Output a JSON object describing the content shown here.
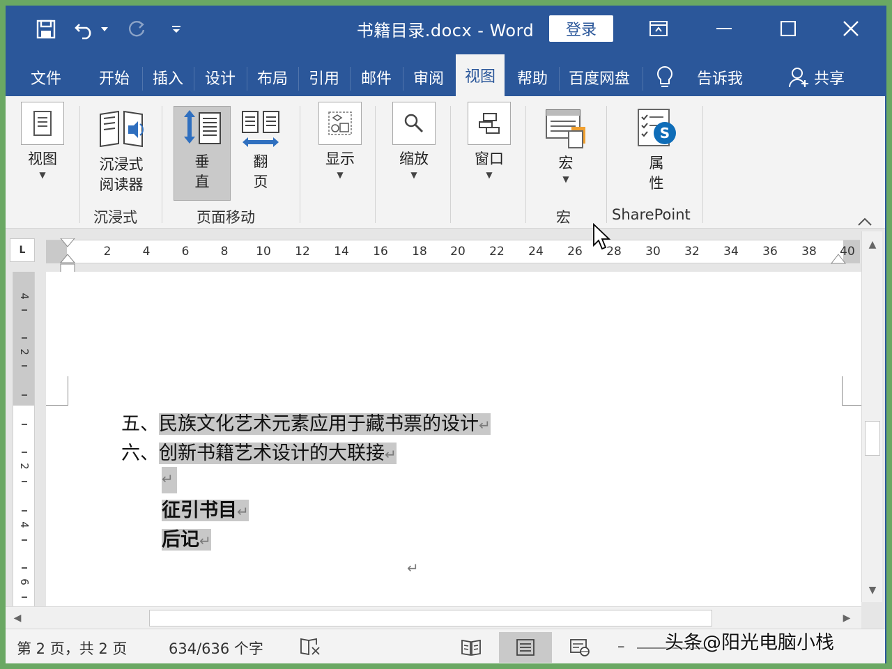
{
  "window": {
    "title": "书籍目录.docx  -  Word",
    "login_label": "登录"
  },
  "tabs": [
    "文件",
    "开始",
    "插入",
    "设计",
    "布局",
    "引用",
    "邮件",
    "审阅",
    "视图",
    "帮助",
    "百度网盘"
  ],
  "active_tab": "视图",
  "tellme_label": "告诉我",
  "share_label": "共享",
  "ribbon": {
    "view_label": "视图",
    "immersive_l1": "沉浸式",
    "immersive_l2": "阅读器",
    "immersive_group": "沉浸式",
    "vertical_l1": "垂",
    "vertical_l2": "直",
    "flip_l1": "翻",
    "flip_l2": "页",
    "pagemove_group": "页面移动",
    "show_label": "显示",
    "zoom_label": "缩放",
    "window_label": "窗口",
    "macro_label": "宏",
    "macro_group": "宏",
    "props_l1": "属",
    "props_l2": "性",
    "sharepoint_group": "SharePoint"
  },
  "ruler": {
    "tab_selector": "L",
    "ticks": [
      "2",
      "4",
      "6",
      "8",
      "10",
      "12",
      "14",
      "16",
      "18",
      "20",
      "22",
      "24",
      "26",
      "28",
      "30",
      "32",
      "34",
      "36",
      "38",
      "40"
    ],
    "vticks": [
      "4",
      "2",
      "2",
      "4",
      "6"
    ]
  },
  "document": {
    "line1_num": "五、",
    "line1_text": "民族文化艺术元素应用于藏书票的设计",
    "line2_num": "六、",
    "line2_text": "创新书籍艺术设计的大联接",
    "line4_text": "征引书目",
    "line5_text": "后记",
    "para_mark": "↵"
  },
  "status": {
    "page_info": "第 2 页，共 2 页",
    "word_count": "634/636 个字",
    "zoom_minus": "–"
  },
  "watermark": "头条@阳光电脑小栈",
  "colors": {
    "brand": "#2b579a",
    "highlight": "#c8c8c8"
  }
}
